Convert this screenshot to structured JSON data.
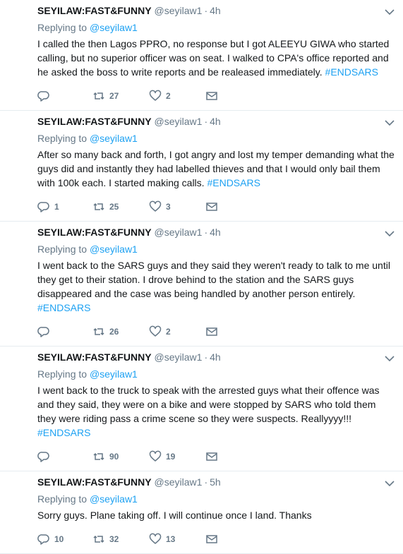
{
  "tweets": [
    {
      "name": "SEYILAW:FAST&FUNNY",
      "handle": "@seyilaw1",
      "time": "4h",
      "replying_prefix": "Replying to",
      "replying_to": "@seyilaw1",
      "text": "I called the then Lagos PPRO, no response but I got ALEEYU GIWA who started calling, but no superior officer was on seat. I walked to CPA's office reported and he asked the boss to write reports and be realeased immediately.",
      "hashtag": "#ENDSARS",
      "replies": "",
      "retweets": "27",
      "likes": "2"
    },
    {
      "name": "SEYILAW:FAST&FUNNY",
      "handle": "@seyilaw1",
      "time": "4h",
      "replying_prefix": "Replying to",
      "replying_to": "@seyilaw1",
      "text": "After so many back and forth, I got angry and lost my temper demanding what the guys did and instantly they had labelled thieves and that I would only bail them with 100k each. I started making calls.",
      "hashtag": "#ENDSARS",
      "replies": "1",
      "retweets": "25",
      "likes": "3"
    },
    {
      "name": "SEYILAW:FAST&FUNNY",
      "handle": "@seyilaw1",
      "time": "4h",
      "replying_prefix": "Replying to",
      "replying_to": "@seyilaw1",
      "text": "I went back to the SARS guys and they said they weren't ready to talk to me until they get to their station. I drove behind to the station and the SARS guys disappeared and the case was being handled by another person entirely.",
      "hashtag": "#ENDSARS",
      "replies": "",
      "retweets": "26",
      "likes": "2"
    },
    {
      "name": "SEYILAW:FAST&FUNNY",
      "handle": "@seyilaw1",
      "time": "4h",
      "replying_prefix": "Replying to",
      "replying_to": "@seyilaw1",
      "text": "I went back to the truck to speak with the arrested guys what their offence was and they said, they were on a bike and were stopped by SARS who told them they were riding pass a crime scene so they were suspects. Reallyyyy!!!",
      "hashtag": "#ENDSARS",
      "replies": "",
      "retweets": "90",
      "likes": "19"
    },
    {
      "name": "SEYILAW:FAST&FUNNY",
      "handle": "@seyilaw1",
      "time": "5h",
      "replying_prefix": "Replying to",
      "replying_to": "@seyilaw1",
      "text": "Sorry guys. Plane taking off. I will continue once I land. Thanks",
      "hashtag": "",
      "replies": "10",
      "retweets": "32",
      "likes": "13"
    }
  ],
  "icons": {
    "reply": "reply-icon",
    "retweet": "retweet-icon",
    "like": "heart-icon",
    "dm": "direct-message-icon",
    "caret": "chevron-down-icon"
  },
  "colors": {
    "link": "#1da1f2",
    "muted": "#657786",
    "text": "#14171a",
    "divider": "#e6ecf0"
  }
}
